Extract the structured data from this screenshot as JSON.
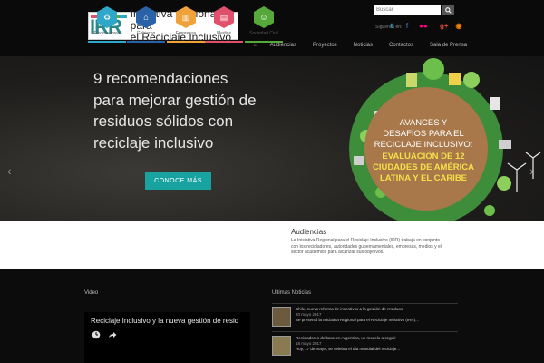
{
  "header": {
    "logo_letters": "IRR",
    "logo_text_line1": "Iniciativa Regional para",
    "logo_text_line2": "el Reciclaje Inclusivo",
    "search_placeholder": "Buscar",
    "follow_label": "Síguenos en:"
  },
  "nav": {
    "items": [
      "Audiencias",
      "Proyectos",
      "Noticias",
      "Contactos",
      "Sala de Prensa"
    ]
  },
  "hero": {
    "title": "9 recomendaciones para mejorar gestión de residuos sólidos con reciclaje inclusivo",
    "cta_label": "CONOCE MÁS",
    "graphic_line1": "AVANCES Y",
    "graphic_line2": "DESAFÍOS PARA EL",
    "graphic_line3": "RECICLAJE INCLUSIVO:",
    "graphic_line4": "EVALUACIÓN DE 12",
    "graphic_line5": "CIUDADES DE AMÉRICA",
    "graphic_line6": "LATINA Y EL CARIBE"
  },
  "audiences": {
    "heading": "Audiencias",
    "description": "La Iniciativa Regional para el Reciclaje Inclusivo (IRR) trabaja en conjunto con los recicladores, autoridades gubernamentales, empresas, medios y el sector académico para alcanzar sus objetivos.",
    "items": [
      {
        "label": "Recicladores",
        "color": "#2ea7c9",
        "icon": "recycle-icon"
      },
      {
        "label": "Gobierno",
        "color": "#2a62a8",
        "icon": "government-icon"
      },
      {
        "label": "Empresas",
        "color": "#f0a23a",
        "icon": "building-icon"
      },
      {
        "label": "Medios",
        "color": "#e0506a",
        "icon": "book-icon"
      },
      {
        "label": "Sociedad Civil",
        "color": "#57a83a",
        "icon": "people-icon"
      }
    ]
  },
  "video": {
    "section_title": "Video",
    "title": "Reciclaje Inclusivo y la nueva gestión de resid"
  },
  "news": {
    "section_title": "Últimas Noticias",
    "items": [
      {
        "title": "Chile, nueva reforma de incentivos a la gestión de residuos",
        "date": "20 mayo 2017",
        "excerpt": "Se presentó la Iniciativa Regional para el Reciclaje Inclusivo (IRR)..."
      },
      {
        "title": "Recicladores de base en Argentina, un modelo a seguir",
        "date": "18 mayo 2017",
        "excerpt": "Hoy, 17 de mayo, se celebra el día mundial del reciclaje..."
      }
    ]
  },
  "colors": {
    "accent": "#18a3a0",
    "logo_bars": [
      "#e0506a",
      "#f0a23a",
      "#f5d33a",
      "#57a83a",
      "#2ea7c9"
    ]
  }
}
